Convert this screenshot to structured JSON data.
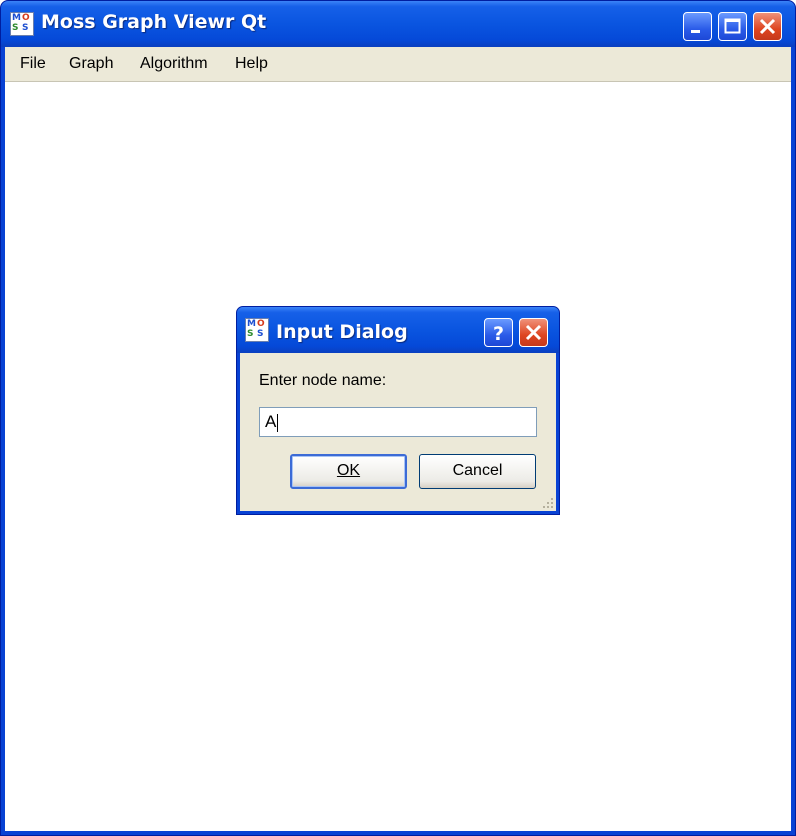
{
  "window": {
    "title": "Moss Graph Viewr Qt",
    "icon": "moss-app-icon",
    "icon_letters": [
      "M",
      "O",
      "S",
      "S"
    ]
  },
  "menubar": {
    "items": [
      "File",
      "Graph",
      "Algorithm",
      "Help"
    ]
  },
  "dialog": {
    "title": "Input Dialog",
    "prompt": "Enter node name:",
    "input_value": "A",
    "ok_label": "OK",
    "cancel_label": "Cancel"
  },
  "colors": {
    "titlebar": "#0a55e0",
    "menubar": "#ece9d8",
    "close": "#de4520",
    "dialog_face": "#ece9d8"
  }
}
